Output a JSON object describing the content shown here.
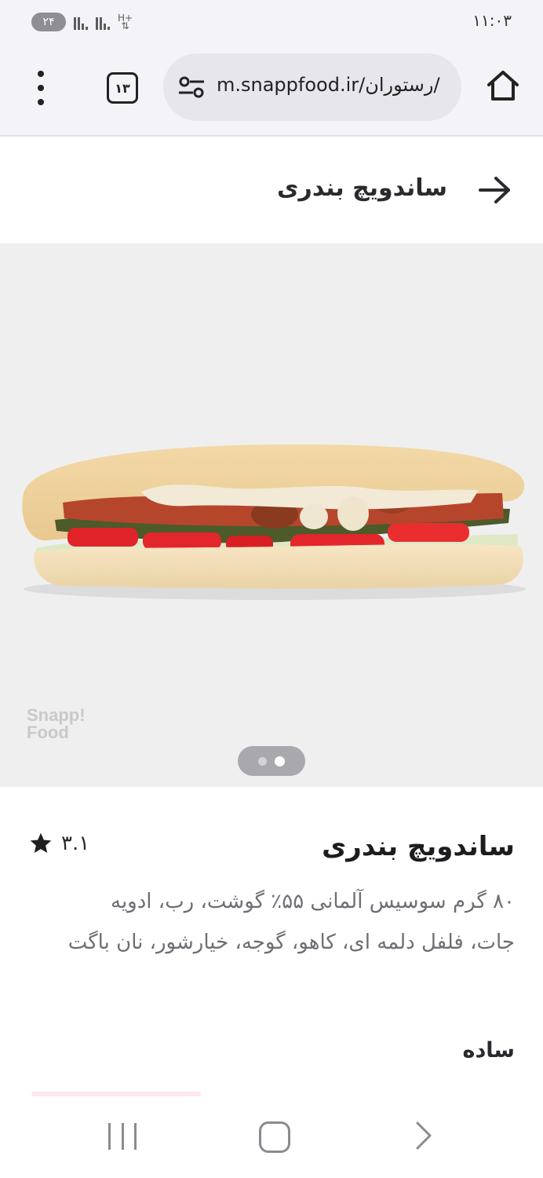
{
  "status_bar": {
    "badge": "۲۴",
    "time": "۱۱:۰۳"
  },
  "browser": {
    "tab_count": "۱۳",
    "url_domain": "m.snappfood.ir/",
    "url_path": "رستوران/"
  },
  "header": {
    "title": "ساندویچ بندری"
  },
  "hero": {
    "watermark_line1": "Snapp!",
    "watermark_line2": "Food",
    "slides": 2,
    "active_slide": 2
  },
  "product": {
    "name": "ساندویچ بندری",
    "rating": "۳.۱",
    "description": "۸۰ گرم سوسیس آلمانی ۵۵٪ گوشت، رب، ادویه جات، فلفل دلمه ای، کاهو، گوجه، خیارشور، نان باگت",
    "variant_label": "ساده"
  },
  "icons": {
    "menu": "more-vert-icon",
    "tabs": "tabs-icon",
    "site_settings": "tune-icon",
    "home": "home-icon",
    "back": "arrow-right-icon",
    "rating": "star-icon"
  }
}
